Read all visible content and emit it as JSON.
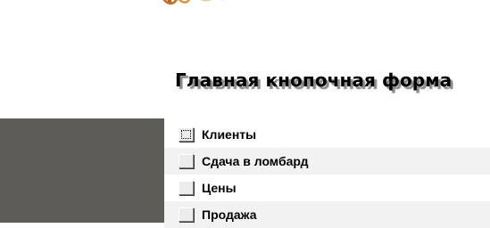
{
  "form": {
    "title": "Главная кнопочная форма"
  },
  "menu": {
    "items": [
      {
        "label": "Клиенты",
        "focused": true
      },
      {
        "label": "Сдача в ломбард",
        "focused": false
      },
      {
        "label": "Цены",
        "focused": false
      },
      {
        "label": "Продажа",
        "focused": false
      }
    ]
  },
  "colors": {
    "left_panel": "#5d5c57",
    "alt_row": "#f2f2f2",
    "logo_accent": "#c8742a"
  }
}
